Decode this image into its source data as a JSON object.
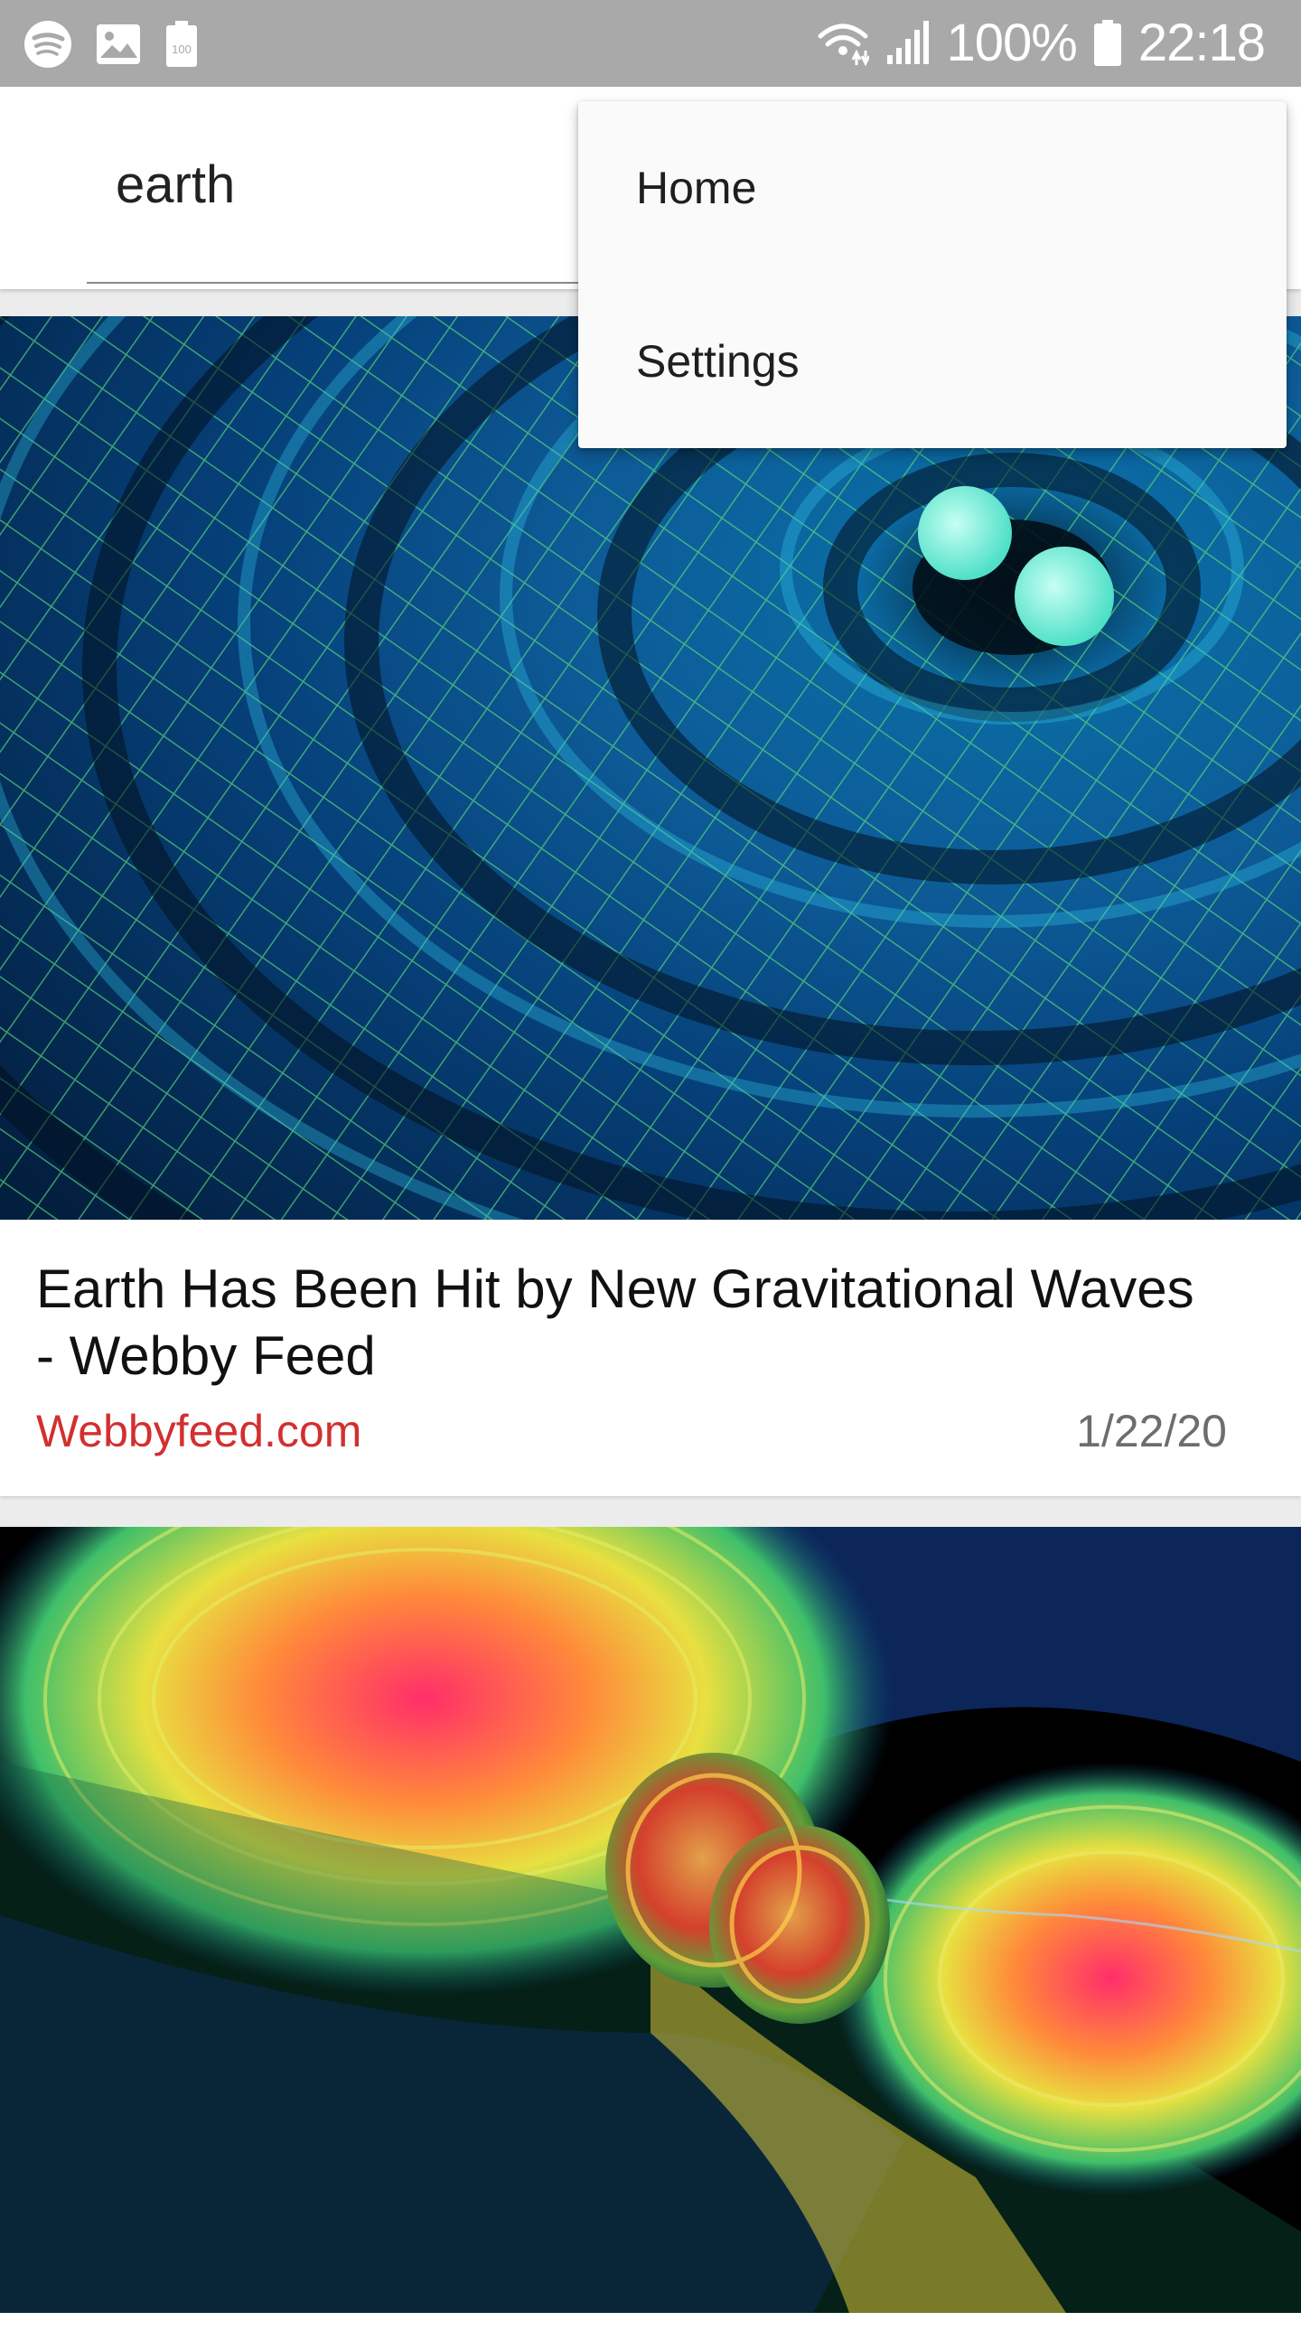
{
  "status_bar": {
    "battery_label": "100",
    "battery_percent": "100%",
    "time": "22:18",
    "icons": [
      "spotify-icon",
      "gallery-icon",
      "battery-saver-icon",
      "wifi-icon",
      "signal-icon",
      "battery-icon"
    ]
  },
  "search": {
    "value": "earth"
  },
  "menu": {
    "items": [
      {
        "label": "Home"
      },
      {
        "label": "Settings"
      }
    ]
  },
  "feed": {
    "items": [
      {
        "title": "Earth Has Been Hit by New Gravitational Waves - Webby Feed",
        "source": "Webbyfeed.com",
        "date": "1/22/20",
        "image": "gravitational-waves-grid-image"
      },
      {
        "image": "gravitational-waves-neutron-star-image"
      }
    ]
  },
  "colors": {
    "status_bar": "#a9a9a9",
    "source_text": "#d32f2f",
    "date_text": "#6d6d6d",
    "menu_bg": "#fafafa"
  }
}
